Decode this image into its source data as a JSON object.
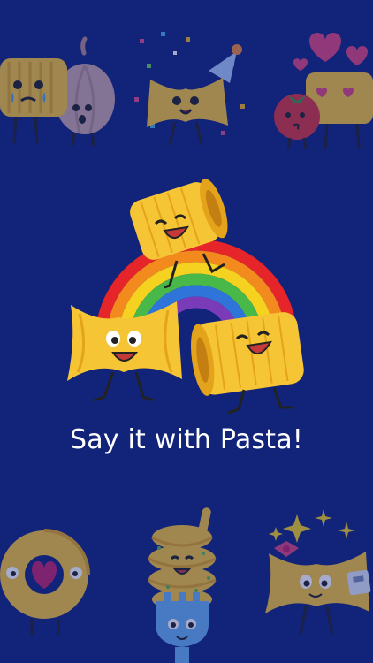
{
  "colors": {
    "background": "#12237a",
    "pasta": "#f6c535",
    "pasta_shadow": "#e3a41c",
    "text": "#ffffff",
    "rainbow": [
      "#e5252a",
      "#f28a1e",
      "#f5d21f",
      "#48b848",
      "#2f74d8",
      "#7a3bb8"
    ]
  },
  "headline": {
    "tagline": "Say it with Pasta!"
  },
  "stickers": {
    "top_row": [
      "crying-pasta-with-garlic",
      "party-bowtie-pasta-with-confetti",
      "kissing-pasta-with-tomato-and-hearts"
    ],
    "center": [
      "rigatoni-on-rainbow",
      "bowtie-pasta-laughing",
      "rigatoni-laughing",
      "rainbow"
    ],
    "bottom_row": [
      "macaroni-ring-with-heart",
      "fusilli-on-fork",
      "bowtie-pasta-with-sparkles-and-gift"
    ]
  }
}
